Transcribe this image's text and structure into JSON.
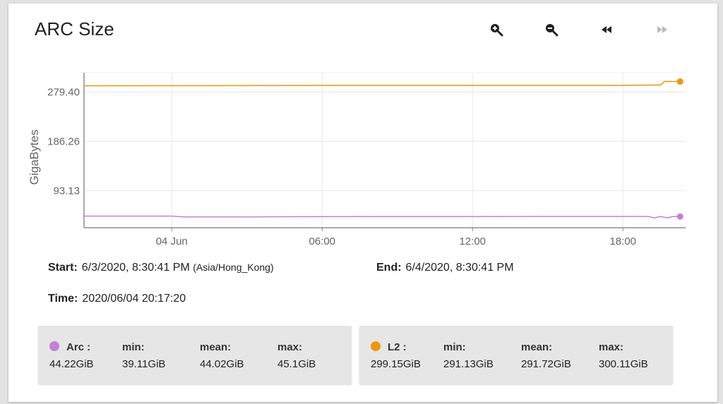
{
  "title": "ARC Size",
  "toolbar": {
    "zoom_in": "zoom-in-icon",
    "zoom_out": "zoom-out-icon",
    "back": "rewind-icon",
    "forward": "fast-forward-icon"
  },
  "info": {
    "start_label": "Start:",
    "start_value": "6/3/2020, 8:30:41 PM",
    "start_tz": "(Asia/Hong_Kong)",
    "end_label": "End:",
    "end_value": "6/4/2020, 8:30:41 PM",
    "time_label": "Time:",
    "time_value": "2020/06/04 20:17:20"
  },
  "legend": [
    {
      "name": "Arc :",
      "color": "#c57fd4",
      "current": "44.22GiB",
      "min_label": "min:",
      "min": "39.11GiB",
      "mean_label": "mean:",
      "mean": "44.02GiB",
      "max_label": "max:",
      "max": "45.1GiB"
    },
    {
      "name": "L2 :",
      "color": "#f0960c",
      "current": "299.15GiB",
      "min_label": "min:",
      "min": "291.13GiB",
      "mean_label": "mean:",
      "mean": "291.72GiB",
      "max_label": "max:",
      "max": "300.11GiB"
    }
  ],
  "chart_data": {
    "type": "line",
    "ylabel": "GigaBytes",
    "yticks": [
      93.13,
      186.26,
      279.4
    ],
    "ytick_labels": [
      "93.13",
      "186.26",
      "279.40"
    ],
    "ylim": [
      23,
      316
    ],
    "xlim": [
      "2020-06-03T20:30",
      "2020-06-04T20:30"
    ],
    "xticks": [
      "2020-06-04T00:00",
      "2020-06-04T06:00",
      "2020-06-04T12:00",
      "2020-06-04T18:00"
    ],
    "xtick_labels": [
      "04 Jun",
      "06:00",
      "12:00",
      "18:00"
    ],
    "grid": true,
    "series": [
      {
        "name": "Arc",
        "color": "#c57fd4",
        "x": [
          "2020-06-03T20:30",
          "2020-06-04T00:00",
          "2020-06-04T00:30",
          "2020-06-04T03:00",
          "2020-06-04T06:00",
          "2020-06-04T12:00",
          "2020-06-04T18:00",
          "2020-06-04T19:00",
          "2020-06-04T19:15",
          "2020-06-04T19:30",
          "2020-06-04T19:45",
          "2020-06-04T20:00",
          "2020-06-04T20:17"
        ],
        "values": [
          45.0,
          45.0,
          43.5,
          43.5,
          44.0,
          44.2,
          44.3,
          44.3,
          41.5,
          44.3,
          41.8,
          44.2,
          44.22
        ]
      },
      {
        "name": "L2",
        "color": "#f0960c",
        "x": [
          "2020-06-03T20:30",
          "2020-06-04T00:00",
          "2020-06-04T06:00",
          "2020-06-04T12:00",
          "2020-06-04T18:00",
          "2020-06-04T18:45",
          "2020-06-04T19:15",
          "2020-06-04T19:30",
          "2020-06-04T19:40",
          "2020-06-04T20:17"
        ],
        "values": [
          291.13,
          291.3,
          291.6,
          291.7,
          291.8,
          292.3,
          292.5,
          292.5,
          299.5,
          299.15
        ]
      }
    ]
  }
}
